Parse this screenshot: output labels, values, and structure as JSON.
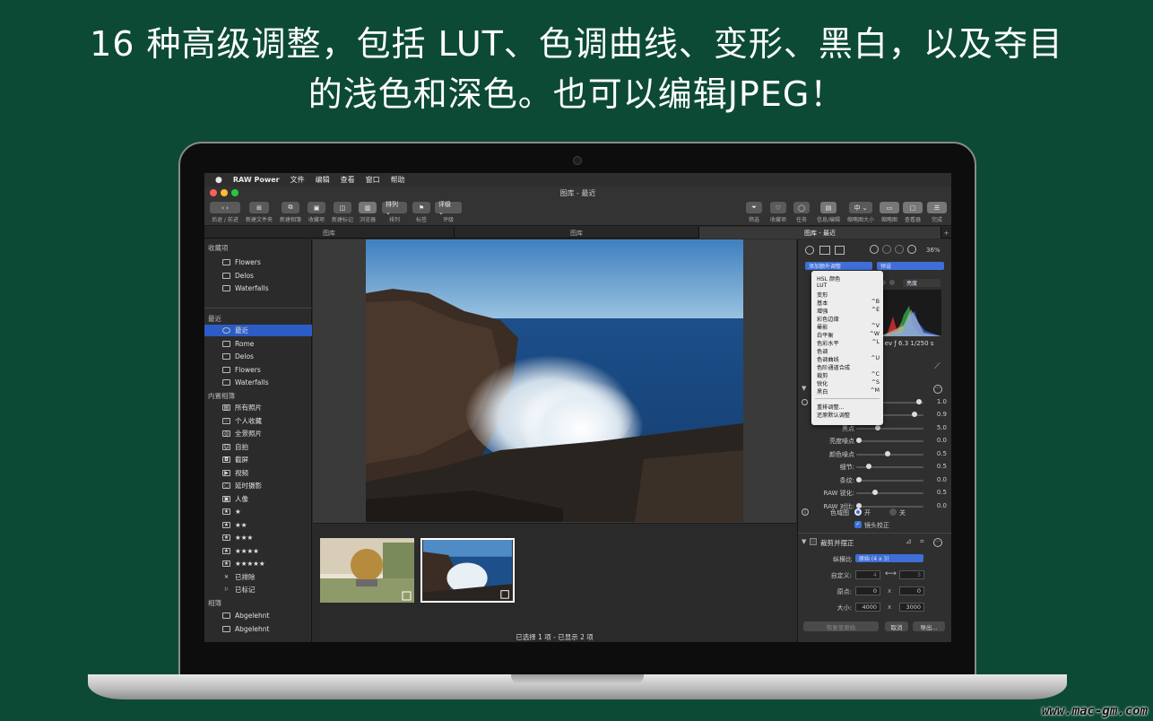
{
  "headline": {
    "line1": "16 种高级调整，包括 LUT、色调曲线、变形、黑白，以及夺目",
    "line2": "的浅色和深色。也可以编辑JPEG！"
  },
  "menubar": {
    "apple": "",
    "app": "RAW Power",
    "items": [
      "文件",
      "编辑",
      "查看",
      "窗口",
      "帮助"
    ]
  },
  "window": {
    "title": "图库 - 最近"
  },
  "toolbar": {
    "left": [
      {
        "btn": "‹ ›",
        "label": "后退 / 前进"
      },
      {
        "btn": "⊞",
        "label": "新建文件夹"
      },
      {
        "btn": "⧉",
        "label": "新建相簿"
      },
      {
        "btn": "▣",
        "label": "收藏项"
      },
      {
        "btn": "◫",
        "label": "新建标记"
      },
      {
        "btn": "▥",
        "label": "浏览器"
      },
      {
        "btn": "排列 ⌄",
        "label": "排列"
      },
      {
        "btn": "⚑",
        "label": "标签"
      },
      {
        "btn": "评级 ⌄",
        "label": "评级"
      }
    ],
    "right": [
      {
        "btn": "⏷",
        "label": "筛选"
      },
      {
        "btn": "♡",
        "label": "收藏项"
      },
      {
        "btn": "◯",
        "label": "任务"
      },
      {
        "btn": "▤",
        "label": "信息/编辑"
      },
      {
        "btn": "中 ⌄",
        "label": "缩略图大小"
      },
      {
        "btn": "▭",
        "label": "缩略图"
      },
      {
        "btn": "▢",
        "label": "查看器"
      },
      {
        "btn": "☰",
        "label": "完成"
      }
    ]
  },
  "tabs": [
    "图库",
    "图库",
    "图库 - 最近"
  ],
  "sidebar": {
    "favorites_header": "收藏项",
    "favorites": [
      "Flowers",
      "Delos",
      "Waterfalls"
    ],
    "recent_header": "最近",
    "recent": [
      "最近",
      "Rome",
      "Delos",
      "Flowers",
      "Waterfalls"
    ],
    "builtin_header": "内置相簿",
    "builtin": [
      {
        "icon": "▤",
        "label": "所有照片"
      },
      {
        "icon": "♡",
        "label": "个人收藏"
      },
      {
        "icon": "◎",
        "label": "全景照片"
      },
      {
        "icon": "☺",
        "label": "自拍"
      },
      {
        "icon": "◘",
        "label": "截屏"
      },
      {
        "icon": "▶",
        "label": "视频"
      },
      {
        "icon": "◌",
        "label": "延时摄影"
      },
      {
        "icon": "▣",
        "label": "人像"
      },
      {
        "icon": "★",
        "label": "★"
      },
      {
        "icon": "★",
        "label": "★★"
      },
      {
        "icon": "★",
        "label": "★★★"
      },
      {
        "icon": "★",
        "label": "★★★★"
      },
      {
        "icon": "★",
        "label": "★★★★★"
      },
      {
        "icon": "✕",
        "label": "已排除"
      },
      {
        "icon": "⚐",
        "label": "已标记"
      }
    ],
    "albums_header": "相簿",
    "albums": [
      "Abgelehnt",
      "Abgelehnt"
    ]
  },
  "status": "已选择 1 项 - 已显示 2 项",
  "right_panel": {
    "zoom": "36%",
    "add_adjustment": "添加额外调整",
    "preset": "预设",
    "brightness": "亮度",
    "exif": "0 ev  ƒ 6.3  1/250 s",
    "menu": [
      {
        "label": "HSL 颜色",
        "key": ""
      },
      {
        "label": "LUT",
        "key": ""
      },
      {
        "label": "变形",
        "key": ""
      },
      {
        "label": "基本",
        "key": "^B"
      },
      {
        "label": "增强",
        "key": "^E"
      },
      {
        "label": "彩色边缘",
        "key": ""
      },
      {
        "label": "晕影",
        "key": "^V"
      },
      {
        "label": "白平衡",
        "key": "^W"
      },
      {
        "label": "色彩水平",
        "key": "^L"
      },
      {
        "label": "色调",
        "key": ""
      },
      {
        "label": "色调曲线",
        "key": "^U"
      },
      {
        "label": "色阶通道合成",
        "key": ""
      },
      {
        "label": "裁剪",
        "key": "^C"
      },
      {
        "label": "锐化",
        "key": "^S"
      },
      {
        "label": "黑白",
        "key": "^M"
      }
    ],
    "menu_extra": [
      "重排调整...",
      "还原默认调整"
    ],
    "sliders": [
      {
        "label": "",
        "value": "1.0",
        "pos": 0.95
      },
      {
        "label": "",
        "value": "0.9",
        "pos": 0.88
      },
      {
        "label": "黑点",
        "value": "5.0",
        "pos": 0.3
      },
      {
        "label": "亮度噪点",
        "value": "0.0",
        "pos": 0.0
      },
      {
        "label": "颜色噪点",
        "value": "0.5",
        "pos": 0.45
      },
      {
        "label": "细节:",
        "value": "0.5",
        "pos": 0.15
      },
      {
        "label": "条纹:",
        "value": "0.0",
        "pos": 0.0
      },
      {
        "label": "RAW 锐化:",
        "value": "0.5",
        "pos": 0.25
      },
      {
        "label": "RAW 对比:",
        "value": "0.0",
        "pos": 0.0
      }
    ],
    "gamut_label": "色域图",
    "gamut_on": "开",
    "gamut_off": "关",
    "lens_label": "镜头校正",
    "crop_header": "裁剪并摆正",
    "aspect_label": "纵横比",
    "aspect_value": "原始 (4 x 3)",
    "custom_label": "自定义:",
    "custom_w": "4",
    "custom_h": "3",
    "origin_label": "原点:",
    "origin_x": "0",
    "origin_y": "0",
    "size_label": "大小:",
    "size_w": "4000",
    "size_h": "3000",
    "x_sep": "x",
    "restore_btn": "恢复至原始",
    "cancel_btn": "取消",
    "export_btn": "导出..."
  },
  "watermark": "www.mac-gm.com"
}
